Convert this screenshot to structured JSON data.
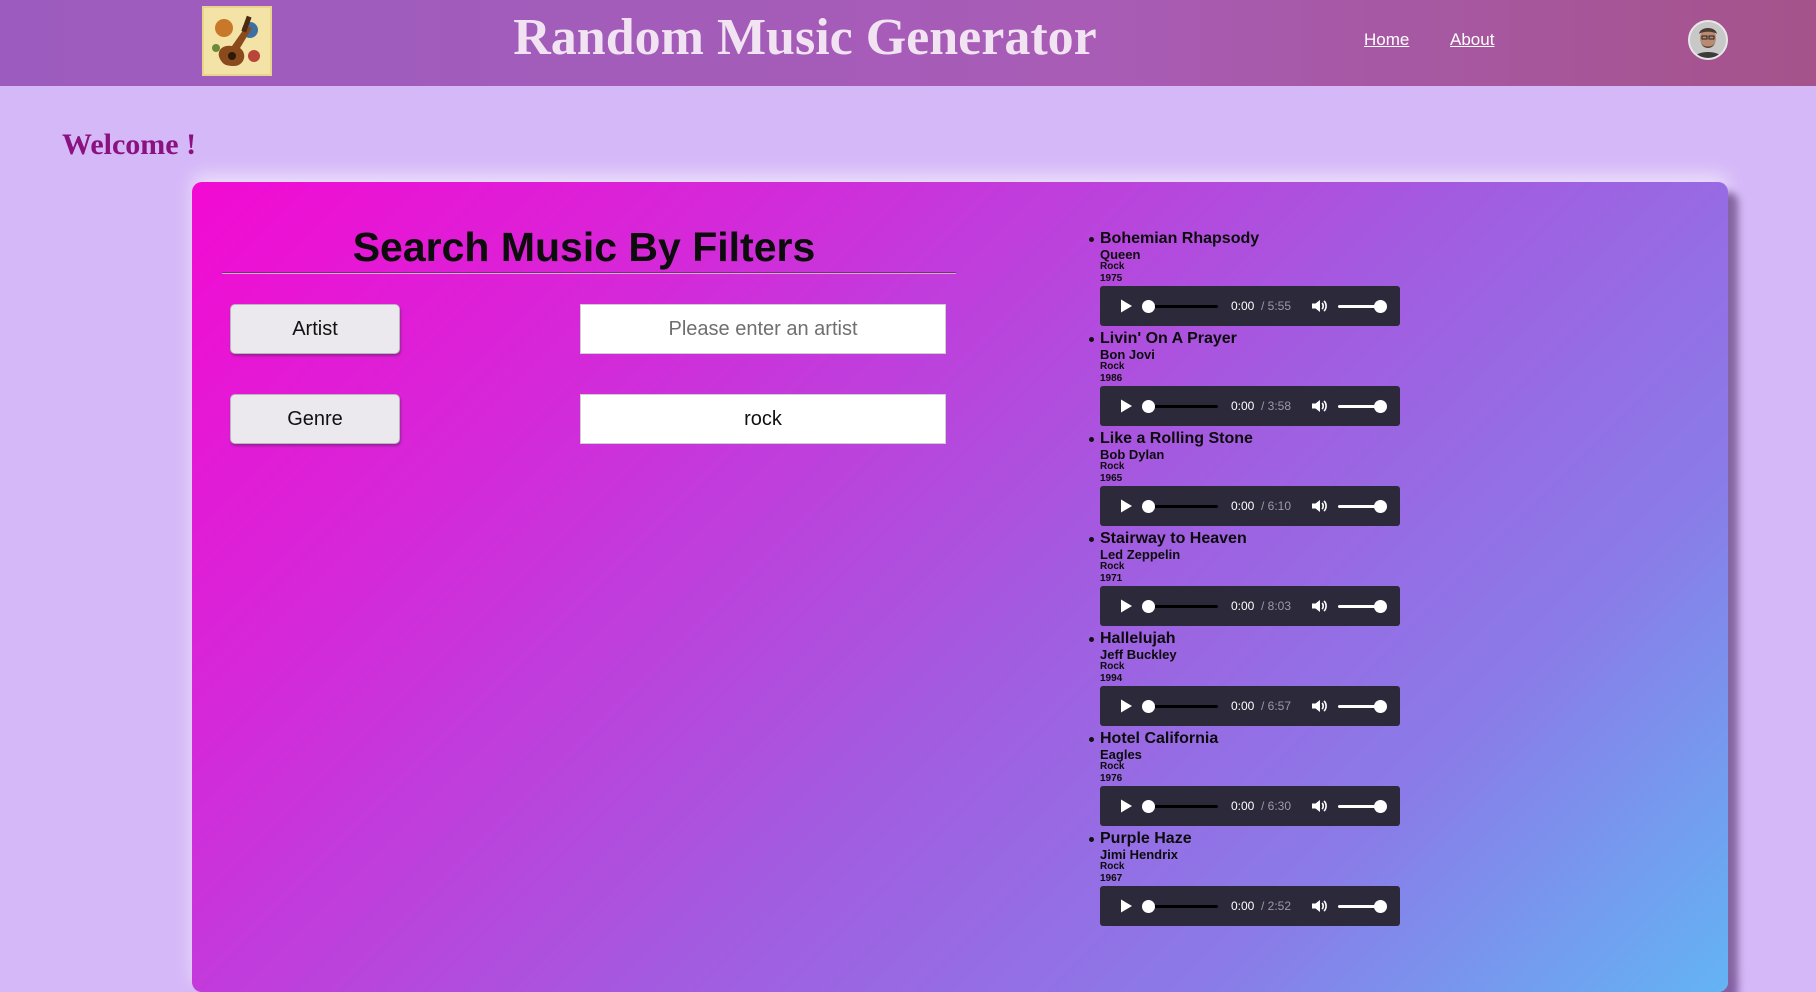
{
  "header": {
    "title": "Random Music Generator",
    "nav": {
      "home": "Home",
      "about": "About"
    },
    "colors": {
      "bar": "#a45bb8",
      "title": "#f1e3f1"
    }
  },
  "welcome": "Welcome !",
  "search": {
    "title": "Search Music By Filters",
    "artist_button": "Artist",
    "artist_placeholder": "Please enter an artist",
    "artist_value": "",
    "genre_button": "Genre",
    "genre_value": "rock"
  },
  "tracks": [
    {
      "title": "Bohemian Rhapsody",
      "artist": "Queen",
      "genre": "Rock",
      "year": "1975",
      "current": "0:00",
      "duration": "/ 5:55"
    },
    {
      "title": "Livin' On A Prayer",
      "artist": "Bon Jovi",
      "genre": "Rock",
      "year": "1986",
      "current": "0:00",
      "duration": "/ 3:58"
    },
    {
      "title": "Like a Rolling Stone",
      "artist": "Bob Dylan",
      "genre": "Rock",
      "year": "1965",
      "current": "0:00",
      "duration": "/ 6:10"
    },
    {
      "title": "Stairway to Heaven",
      "artist": "Led Zeppelin",
      "genre": "Rock",
      "year": "1971",
      "current": "0:00",
      "duration": "/ 8:03"
    },
    {
      "title": "Hallelujah",
      "artist": "Jeff Buckley",
      "genre": "Rock",
      "year": "1994",
      "current": "0:00",
      "duration": "/ 6:57"
    },
    {
      "title": "Hotel California",
      "artist": "Eagles",
      "genre": "Rock",
      "year": "1976",
      "current": "0:00",
      "duration": "/ 6:30"
    },
    {
      "title": "Purple Haze",
      "artist": "Jimi Hendrix",
      "genre": "Rock",
      "year": "1967",
      "current": "0:00",
      "duration": "/ 2:52"
    }
  ],
  "icons": {
    "logo": "guitar-collage-logo",
    "avatar": "user-avatar",
    "play": "play-icon",
    "volume": "volume-icon"
  }
}
